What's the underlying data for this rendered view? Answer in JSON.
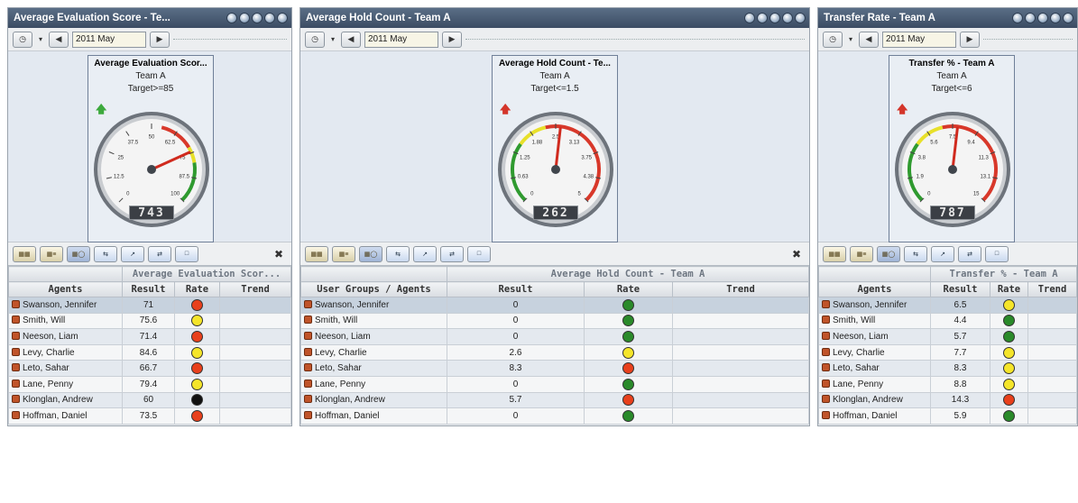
{
  "panels": [
    {
      "title": "Average Evaluation Score - Te...",
      "date": "2011 May",
      "gauge": {
        "title": "Average Evaluation Scor...",
        "team": "Team A",
        "target": "Target>=85",
        "arrow": "up",
        "arrow_color": "#3ca93c",
        "min": 0,
        "max": 100,
        "ticks": [
          "0",
          "12.5",
          "25",
          "37.5",
          "50",
          "62.5",
          "75",
          "87.5",
          "100"
        ],
        "value": 74.3,
        "readout": "743",
        "bands": "green-high"
      },
      "table": {
        "group_header": "Average Evaluation Scor...",
        "headers": [
          "Agents",
          "Result",
          "Rate",
          "Trend"
        ],
        "rows": [
          {
            "name": "Swanson, Jennifer",
            "result": "71",
            "rate": "#e8401c"
          },
          {
            "name": "Smith, Will",
            "result": "75.6",
            "rate": "#f5e52a"
          },
          {
            "name": "Neeson, Liam",
            "result": "71.4",
            "rate": "#e8401c"
          },
          {
            "name": "Levy, Charlie",
            "result": "84.6",
            "rate": "#f5e52a"
          },
          {
            "name": "Leto, Sahar",
            "result": "66.7",
            "rate": "#e8401c"
          },
          {
            "name": "Lane, Penny",
            "result": "79.4",
            "rate": "#f5e52a"
          },
          {
            "name": "Klonglan, Andrew",
            "result": "60",
            "rate": "#111111"
          },
          {
            "name": "Hoffman, Daniel",
            "result": "73.5",
            "rate": "#e8401c"
          }
        ]
      }
    },
    {
      "title": "Average Hold Count - Team A",
      "date": "2011 May",
      "gauge": {
        "title": "Average Hold Count - Te...",
        "team": "Team A",
        "target": "Target<=1.5",
        "arrow": "up",
        "arrow_color": "#d4352a",
        "min": 0,
        "max": 5,
        "ticks": [
          "0",
          "0.63",
          "1.25",
          "1.88",
          "2.5",
          "3.13",
          "3.75",
          "4.38",
          "5"
        ],
        "value": 2.62,
        "readout": "262",
        "bands": "green-low"
      },
      "table": {
        "group_header": "Average Hold Count - Team A",
        "headers": [
          "User Groups / Agents",
          "Result",
          "Rate",
          "Trend"
        ],
        "rows": [
          {
            "name": "Swanson, Jennifer",
            "result": "0",
            "rate": "#2a8a2a"
          },
          {
            "name": "Smith, Will",
            "result": "0",
            "rate": "#2a8a2a"
          },
          {
            "name": "Neeson, Liam",
            "result": "0",
            "rate": "#2a8a2a"
          },
          {
            "name": "Levy, Charlie",
            "result": "2.6",
            "rate": "#f5e52a"
          },
          {
            "name": "Leto, Sahar",
            "result": "8.3",
            "rate": "#e8401c"
          },
          {
            "name": "Lane, Penny",
            "result": "0",
            "rate": "#2a8a2a"
          },
          {
            "name": "Klonglan, Andrew",
            "result": "5.7",
            "rate": "#e8401c"
          },
          {
            "name": "Hoffman, Daniel",
            "result": "0",
            "rate": "#2a8a2a"
          }
        ]
      }
    },
    {
      "title": "Transfer Rate - Team A",
      "date": "2011 May",
      "gauge": {
        "title": "Transfer % - Team A",
        "team": "Team A",
        "target": "Target<=6",
        "arrow": "up",
        "arrow_color": "#d4352a",
        "min": 0,
        "max": 15,
        "ticks": [
          "0",
          "1.9",
          "3.8",
          "5.6",
          "7.5",
          "9.4",
          "11.3",
          "13.1",
          "15"
        ],
        "value": 7.87,
        "readout": "787",
        "bands": "green-low"
      },
      "table": {
        "group_header": "Transfer % - Team A",
        "headers": [
          "Agents",
          "Result",
          "Rate",
          "Trend"
        ],
        "rows": [
          {
            "name": "Swanson, Jennifer",
            "result": "6.5",
            "rate": "#f5e52a"
          },
          {
            "name": "Smith, Will",
            "result": "4.4",
            "rate": "#2a8a2a"
          },
          {
            "name": "Neeson, Liam",
            "result": "5.7",
            "rate": "#2a8a2a"
          },
          {
            "name": "Levy, Charlie",
            "result": "7.7",
            "rate": "#f5e52a"
          },
          {
            "name": "Leto, Sahar",
            "result": "8.3",
            "rate": "#f5e52a"
          },
          {
            "name": "Lane, Penny",
            "result": "8.8",
            "rate": "#f5e52a"
          },
          {
            "name": "Klonglan, Andrew",
            "result": "14.3",
            "rate": "#e8401c"
          },
          {
            "name": "Hoffman, Daniel",
            "result": "5.9",
            "rate": "#2a8a2a"
          }
        ]
      }
    }
  ]
}
